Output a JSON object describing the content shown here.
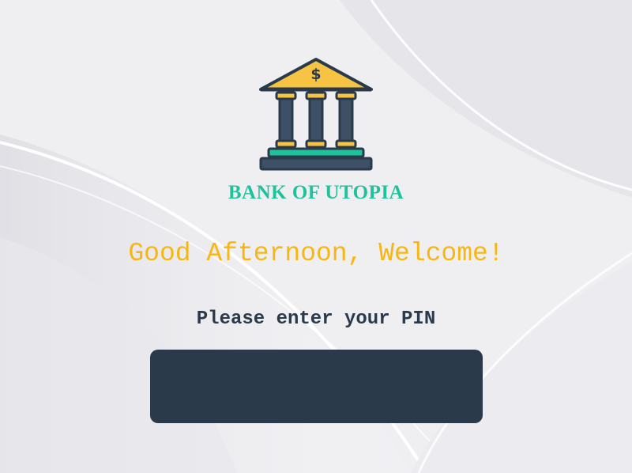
{
  "brand": {
    "name": "BANK OF UTOPIA",
    "logo_icon": "bank-building-icon",
    "logo_symbol": "$",
    "name_color": "#1fc39b"
  },
  "greeting": {
    "text": "Good Afternoon, Welcome!",
    "color": "#f7b612"
  },
  "pin": {
    "prompt": "Please enter your PIN",
    "value": "",
    "placeholder": ""
  },
  "colors": {
    "background": "#f1f1f3",
    "input_background": "#2b3a4b",
    "text_dark": "#2b3a4b"
  }
}
